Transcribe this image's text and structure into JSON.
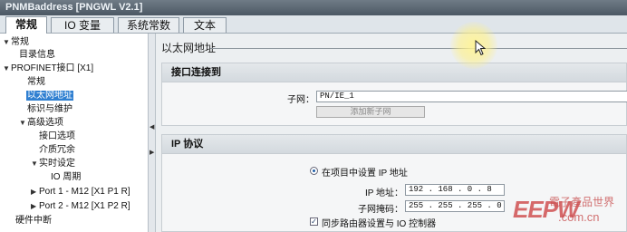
{
  "window": {
    "title": "PNMBaddress [PNGWL V2.1]"
  },
  "tabs": [
    "常规",
    "IO 变量",
    "系统常数",
    "文本"
  ],
  "nav": {
    "items": [
      {
        "label": "常规",
        "arrow": "▼"
      },
      {
        "label": "目录信息",
        "arrow": ""
      },
      {
        "label": "PROFINET接口 [X1]",
        "arrow": "▼"
      },
      {
        "label": "常规",
        "arrow": ""
      },
      {
        "label": "以太网地址",
        "arrow": ""
      },
      {
        "label": "标识与维护",
        "arrow": ""
      },
      {
        "label": "高级选项",
        "arrow": "▼"
      },
      {
        "label": "接口选项",
        "arrow": ""
      },
      {
        "label": "介质冗余",
        "arrow": ""
      },
      {
        "label": "实时设定",
        "arrow": "▼"
      },
      {
        "label": "IO 周期",
        "arrow": ""
      },
      {
        "label": "Port 1 - M12 [X1 P1 R]",
        "arrow": "▶"
      },
      {
        "label": "Port 2 - M12 [X1 P2 R]",
        "arrow": "▶"
      },
      {
        "label": "硬件中断",
        "arrow": ""
      }
    ],
    "selected": "以太网地址"
  },
  "main": {
    "section_title": "以太网地址",
    "interface": {
      "heading": "接口连接到",
      "subnet_label": "子网：",
      "subnet_value": "PN/IE_1",
      "add_subnet_button": "添加新子网"
    },
    "ip_protocol": {
      "heading": "IP 协议",
      "radio_label": "在项目中设置 IP 地址",
      "ip_label": "IP 地址：",
      "ip_value": "192 . 168 . 0  . 8",
      "mask_label": "子网掩码：",
      "mask_value": "255 . 255 . 255 . 0",
      "router_sync_label": "同步路由器设置与 IO 控制器"
    }
  },
  "watermark": {
    "logo": "EEPW",
    "cn": "電子產品世界",
    "url": ".com.cn"
  }
}
